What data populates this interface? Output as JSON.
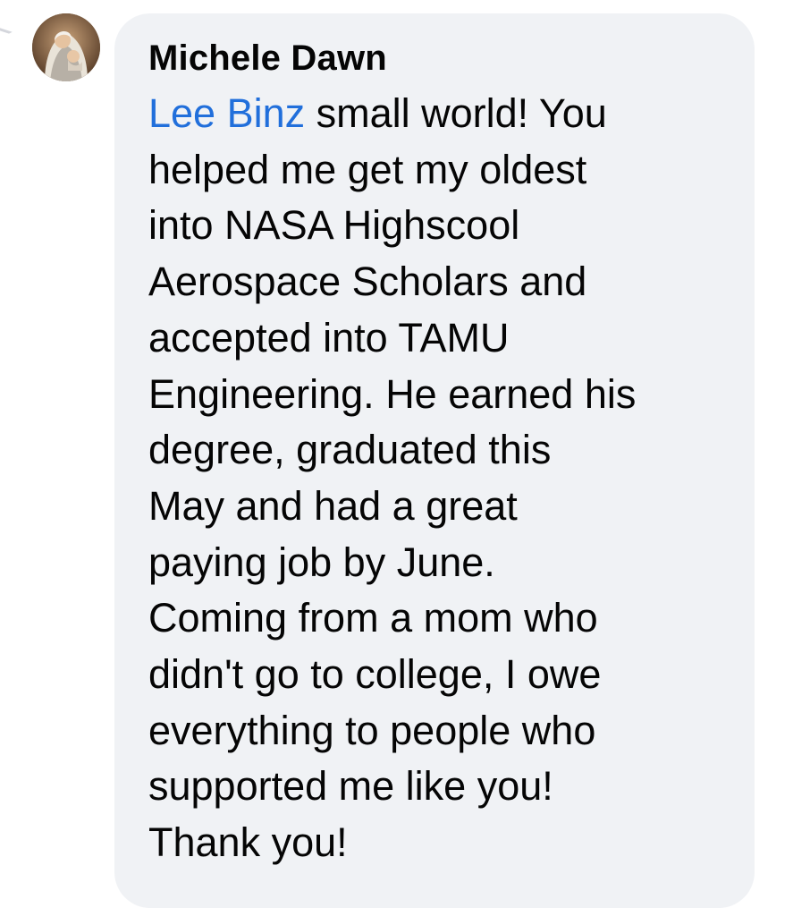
{
  "comment": {
    "author": "Michele Dawn",
    "mention": "Lee Binz",
    "lines": [
      " small world! You",
      "helped me get my oldest",
      "into NASA Highscool",
      "Aerospace Scholars and",
      "accepted into TAMU",
      "Engineering. He earned his",
      "degree, graduated this",
      "May and had a great",
      "paying job by June.",
      "Coming from a mom who",
      "didn't go to college, I owe",
      "everything to people who",
      "supported me like you!",
      "Thank you!"
    ]
  },
  "colors": {
    "bubble": "#f0f2f5",
    "mention": "#216fdb",
    "text": "#050505"
  },
  "icons": {
    "avatar": "profile-photo"
  }
}
